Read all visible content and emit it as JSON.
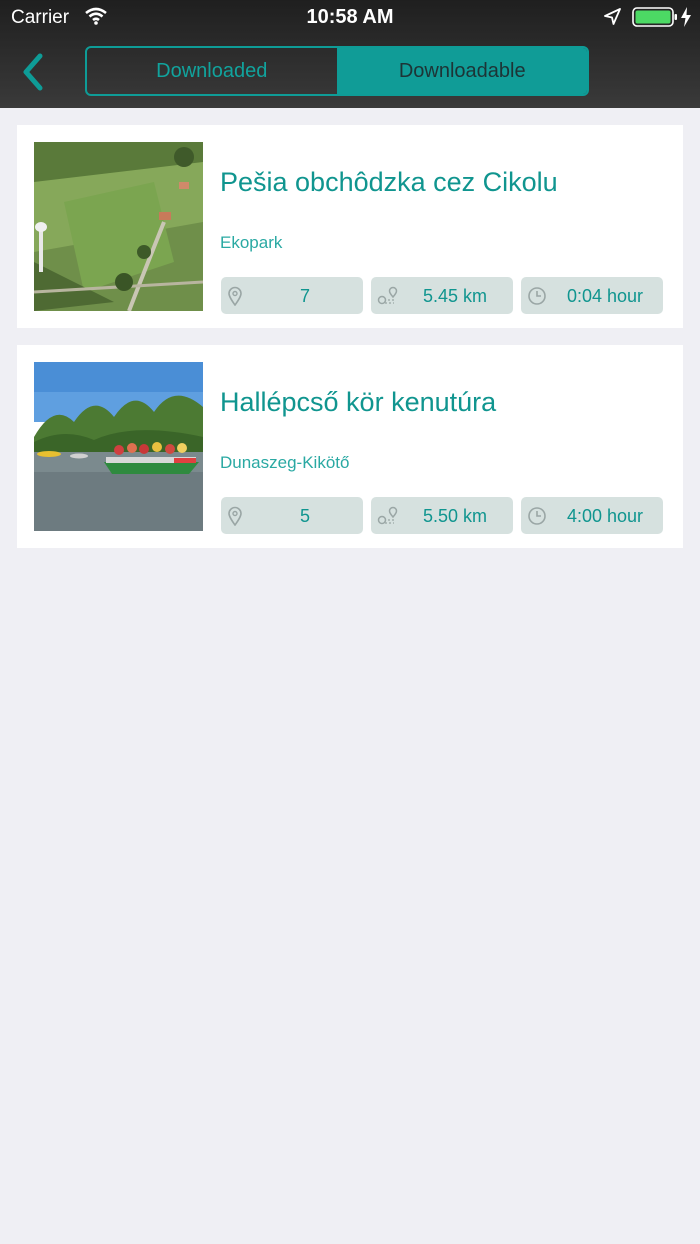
{
  "status_bar": {
    "carrier": "Carrier",
    "time": "10:58 AM",
    "battery_color": "#4cd964"
  },
  "nav": {
    "tabs": [
      {
        "label": "Downloaded",
        "selected": false
      },
      {
        "label": "Downloadable",
        "selected": true
      }
    ],
    "accent": "#0e9c97"
  },
  "tours": [
    {
      "title": "Pešia obchôdzka cez Cikolu",
      "location": "Ekopark",
      "points": "7",
      "distance": "5.45 km",
      "duration": "0:04 hour"
    },
    {
      "title": "Hallépcső kör kenutúra",
      "location": "Dunaszeg-Kikötő",
      "points": "5",
      "distance": "5.50 km",
      "duration": "4:00 hour"
    }
  ]
}
